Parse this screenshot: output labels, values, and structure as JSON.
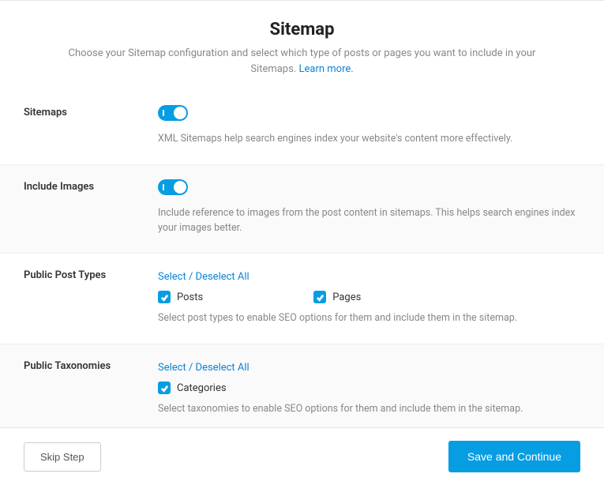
{
  "header": {
    "title": "Sitemap",
    "description_part1": "Choose your Sitemap configuration and select which type of posts or pages you want to include in your Sitemaps. ",
    "learn_more": "Learn more."
  },
  "sitemaps": {
    "label": "Sitemaps",
    "enabled": true,
    "description": "XML Sitemaps help search engines index your website's content more effectively."
  },
  "include_images": {
    "label": "Include Images",
    "enabled": true,
    "description": "Include reference to images from the post content in sitemaps. This helps search engines index your images better."
  },
  "public_post_types": {
    "label": "Public Post Types",
    "select_all": "Select / Deselect All",
    "options": [
      {
        "label": "Posts",
        "checked": true
      },
      {
        "label": "Pages",
        "checked": true
      }
    ],
    "description": "Select post types to enable SEO options for them and include them in the sitemap."
  },
  "public_taxonomies": {
    "label": "Public Taxonomies",
    "select_all": "Select / Deselect All",
    "options": [
      {
        "label": "Categories",
        "checked": true
      }
    ],
    "description": "Select taxonomies to enable SEO options for them and include them in the sitemap."
  },
  "footer": {
    "skip": "Skip Step",
    "save": "Save and Continue"
  }
}
